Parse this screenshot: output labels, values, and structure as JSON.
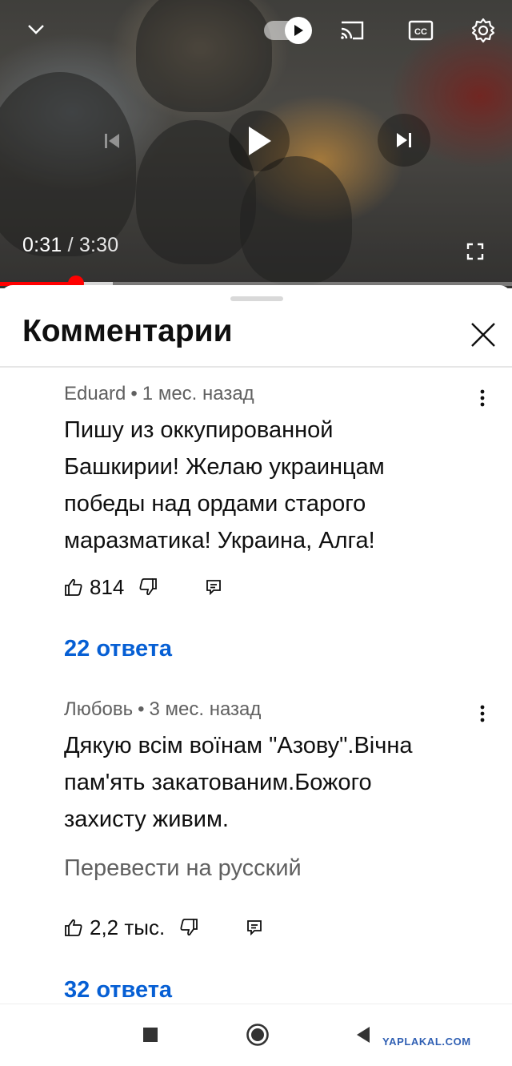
{
  "player": {
    "current_time": "0:31",
    "separator": "/",
    "duration": "3:30",
    "progress_fraction": 0.148,
    "buffered_fraction": 0.22
  },
  "comments_panel": {
    "title": "Комментарии"
  },
  "comments": [
    {
      "author": "Eduard",
      "dot": "•",
      "time": "1 мес. назад",
      "text_lines": [
        "Пишу из оккупированной",
        "Башкирии! Желаю украинцам",
        "победы над ордами старого",
        "маразматика! Украина, Алга!"
      ],
      "likes": "814",
      "replies": "22 ответа"
    },
    {
      "author": "Любовь",
      "dot": "•",
      "time": "3 мес. назад",
      "text_lines": [
        "Дякую всім воїнам \"Азову\".Вічна",
        "пам'ять закатованим.Божого",
        "захисту живим."
      ],
      "translate": "Перевести на русский",
      "likes": "2,2 тыс.",
      "replies": "32 ответа"
    }
  ],
  "watermark": "YAPLAKAL.COM",
  "colors": {
    "accent_link": "#065fd4",
    "progress_red": "#ff0000",
    "meta_gray": "#606060"
  },
  "icons": [
    "chevron-down-icon",
    "autoplay-toggle",
    "cast-icon",
    "captions-icon",
    "settings-icon",
    "previous-icon",
    "play-icon",
    "next-icon",
    "fullscreen-icon",
    "close-icon",
    "more-vert-icon",
    "like-icon",
    "dislike-icon",
    "reply-icon",
    "nav-recents-icon",
    "nav-home-icon",
    "nav-back-icon"
  ]
}
